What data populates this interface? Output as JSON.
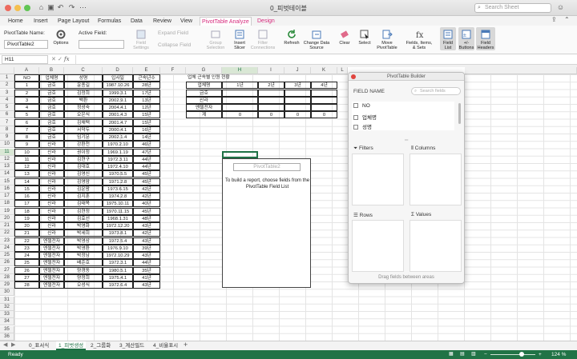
{
  "window": {
    "title": "0_피벗테이블",
    "search_placeholder": "Search Sheet"
  },
  "menu_tabs": [
    "Home",
    "Insert",
    "Page Layout",
    "Formulas",
    "Data",
    "Review",
    "View",
    "PivotTable Analyze",
    "Design"
  ],
  "ribbon": {
    "pivot_name_label": "PivotTable Name:",
    "pivot_name_value": "PivotTable2",
    "active_field_label": "Active Field:",
    "options_label": "Options",
    "field_settings_label": "Field Settings",
    "expand_field_label": "Expand Field",
    "collapse_field_label": "Collapse Field",
    "group_selection_label": "Group Selection",
    "insert_slicer_label": "Insert Slicer",
    "filter_connections_label": "Filter Connections",
    "refresh_label": "Refresh",
    "change_source_label": "Change Data Source",
    "clear_label": "Clear",
    "select_label": "Select",
    "move_pivot_label": "Move PivotTable",
    "fields_items_label": "Fields, Items, & Sets",
    "field_list_label": "Field List",
    "buttons_label": "+/- Buttons",
    "field_headers_label": "Field Headers"
  },
  "formula_bar": {
    "name_box": "H11",
    "fx": "fx"
  },
  "columns": [
    "A",
    "B",
    "C",
    "D",
    "E",
    "F",
    "G",
    "H",
    "I",
    "J",
    "K",
    "L"
  ],
  "rows": [
    "1",
    "2",
    "3",
    "4",
    "5",
    "6",
    "7",
    "8",
    "9",
    "10",
    "11",
    "12",
    "13",
    "14",
    "15",
    "16",
    "17",
    "18",
    "19",
    "20",
    "21",
    "22",
    "23",
    "24",
    "25",
    "26",
    "27",
    "28",
    "29",
    "30",
    "31",
    "32",
    "33",
    "34",
    "35",
    "36"
  ],
  "employee_table": {
    "headers": [
      "NO",
      "업체명",
      "성명",
      "입사일",
      "근속년수"
    ],
    "rows": [
      [
        "1",
        "금호",
        "윤종길",
        "1987.10.26",
        "28년"
      ],
      [
        "2",
        "금호",
        "김정희",
        "1999.3.1",
        "17년"
      ],
      [
        "3",
        "금호",
        "백환",
        "2002.9.1",
        "13년"
      ],
      [
        "4",
        "금호",
        "정성숙",
        "2004.4.1",
        "12년"
      ],
      [
        "5",
        "금호",
        "오은식",
        "2001.4.3",
        "15년"
      ],
      [
        "6",
        "금호",
        "김채택",
        "2001.4.7",
        "15년"
      ],
      [
        "7",
        "금호",
        "서덕두",
        "2000.4.1",
        "16년"
      ],
      [
        "8",
        "금호",
        "임기문",
        "2002.1.4",
        "14년"
      ],
      [
        "9",
        "신라",
        "강환천",
        "1970.2.10",
        "46년"
      ],
      [
        "10",
        "신라",
        "권이정",
        "1969.1.19",
        "47년"
      ],
      [
        "11",
        "신라",
        "김현구",
        "1972.3.11",
        "44년"
      ],
      [
        "12",
        "신라",
        "김대호",
        "1972.4.10",
        "44년"
      ],
      [
        "13",
        "신라",
        "김영신",
        "1970.5.5",
        "45년"
      ],
      [
        "14",
        "신라",
        "김영암",
        "1971.2.8",
        "45년"
      ],
      [
        "15",
        "신라",
        "김운왕",
        "1973.6.15",
        "42년"
      ],
      [
        "16",
        "신라",
        "김지훈",
        "1974.2.8",
        "42년"
      ],
      [
        "17",
        "신라",
        "김태목",
        "1975.10.11",
        "40년"
      ],
      [
        "18",
        "신라",
        "김현정",
        "1970.11.15",
        "45년"
      ],
      [
        "19",
        "신라",
        "김효선",
        "1968.1.31",
        "48년"
      ],
      [
        "20",
        "신라",
        "박영화",
        "1972.12.20",
        "43년"
      ],
      [
        "21",
        "신라",
        "박세희",
        "1973.8.1",
        "42년"
      ],
      [
        "22",
        "엔젤전자",
        "박영상",
        "1972.5.4",
        "43년"
      ],
      [
        "23",
        "엔젤전자",
        "박영환",
        "1976.9.10",
        "39년"
      ],
      [
        "24",
        "엔젤전자",
        "박정남",
        "1972.10.29",
        "43년"
      ],
      [
        "25",
        "엔젤전자",
        "배준호",
        "1972.3.1",
        "44년"
      ],
      [
        "26",
        "엔젤전자",
        "양경동",
        "1980.5.1",
        "35년"
      ],
      [
        "27",
        "엔젤전자",
        "양정희",
        "1975.4.1",
        "41년"
      ],
      [
        "28",
        "엔젤전자",
        "오성식",
        "1972.6.4",
        "43년"
      ]
    ]
  },
  "summary_table": {
    "title": "업체 근속별 인원 현황",
    "header": [
      "업체명",
      "1년",
      "2년",
      "3년",
      "4년"
    ],
    "rows": [
      "금호",
      "신라",
      "엔젤전자"
    ],
    "total_label": "계",
    "totals": [
      "0",
      "0",
      "0",
      "0"
    ]
  },
  "pivot_placeholder": {
    "name": "PivotTable2",
    "message": "To build a report, choose fields from the PivotTable Field List"
  },
  "builder": {
    "title": "PivotTable Builder",
    "field_name_label": "FIELD NAME",
    "search_placeholder": "Search fields",
    "fields": [
      "NO",
      "업체명",
      "성명"
    ],
    "filters_label": "Filters",
    "columns_label": "Columns",
    "rows_label": "Rows",
    "values_label": "Values",
    "footer": "Drag fields between areas"
  },
  "sheet_tabs": [
    "0_표서식",
    "1_피벗생성",
    "2_그룹화",
    "3_계산필드",
    "4_비율표시"
  ],
  "status": {
    "ready": "Ready",
    "zoom": "124 %"
  }
}
